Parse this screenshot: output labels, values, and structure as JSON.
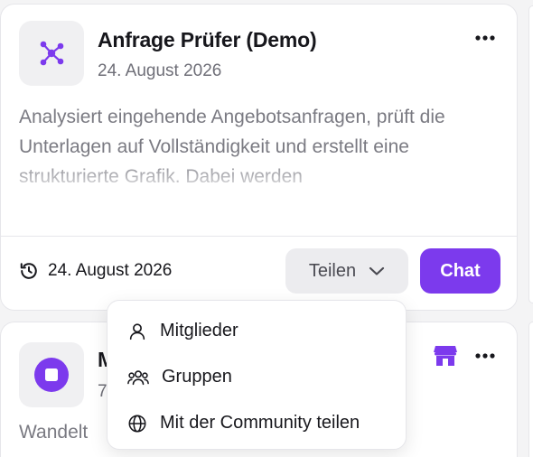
{
  "card1": {
    "title": "Anfrage Prüfer (Demo)",
    "date": "24. August 2026",
    "description": "Analysiert eingehende Angebotsanfragen, prüft die Unterlagen auf Vollständigkeit und erstellt eine strukturierte Grafik. Dabei werden",
    "footer_date": "24. August 2026",
    "share_label": "Teilen",
    "chat_label": "Chat",
    "icon": "network-nodes-icon"
  },
  "card2": {
    "title_visible": "M",
    "date_visible": "7.",
    "description_visible": "Wandelt",
    "icon": "stop-square-icon"
  },
  "share_menu": {
    "items": [
      {
        "label": "Mitglieder",
        "icon": "user-icon"
      },
      {
        "label": "Gruppen",
        "icon": "users-group-icon"
      },
      {
        "label": "Mit der Community teilen",
        "icon": "globe-icon"
      }
    ]
  },
  "colors": {
    "accent": "#7c3aed",
    "text": "#17171c",
    "muted": "#6f6f78"
  }
}
